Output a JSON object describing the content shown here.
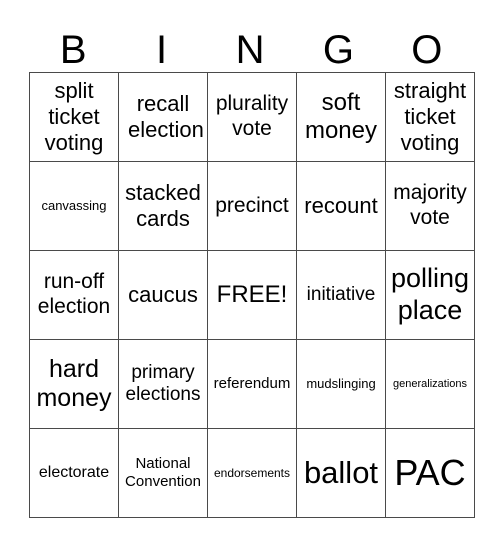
{
  "header": {
    "letters": [
      "B",
      "I",
      "N",
      "G",
      "O"
    ]
  },
  "rows": [
    [
      "split ticket voting",
      "recall election",
      "plurality vote",
      "soft money",
      "straight ticket voting"
    ],
    [
      "canvassing",
      "stacked cards",
      "precinct",
      "recount",
      "majority vote"
    ],
    [
      "run-off election",
      "caucus",
      "FREE!",
      "initiative",
      "polling place"
    ],
    [
      "hard money",
      "primary elections",
      "referendum",
      "mudslinging",
      "generalizations"
    ],
    [
      "electorate",
      "National Convention",
      "endorsements",
      "ballot",
      "PAC"
    ]
  ]
}
